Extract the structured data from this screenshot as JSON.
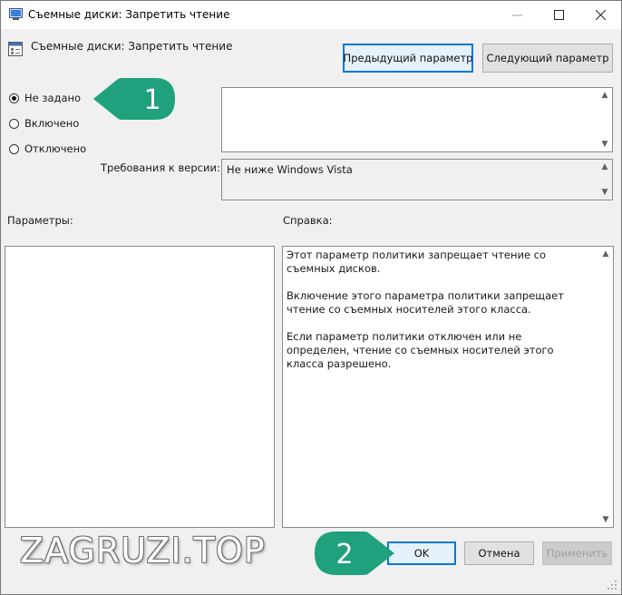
{
  "window": {
    "title": "Съемные диски: Запретить чтение",
    "controls": {
      "minimize": "—",
      "maximize": "☐",
      "close": "✕"
    }
  },
  "header": {
    "policy_name": "Съемные диски: Запретить чтение",
    "prev_button": "Предыдущий параметр",
    "next_button": "Следующий параметр"
  },
  "state": {
    "options": [
      {
        "label": "Не задано",
        "checked": true
      },
      {
        "label": "Включено",
        "checked": false
      },
      {
        "label": "Отключено",
        "checked": false
      }
    ]
  },
  "comment": {
    "value": ""
  },
  "requirements": {
    "label": "Требования к версии:",
    "value": "Не ниже Windows Vista"
  },
  "options_panel": {
    "label": "Параметры:"
  },
  "help_panel": {
    "label": "Справка:",
    "paragraphs": [
      "Этот параметр политики запрещает чтение со съемных дисков.",
      "Включение этого параметра политики запрещает чтение со съемных носителей этого класса.",
      "Если параметр политики отключен или не определен, чтение со съемных носителей этого класса разрешено."
    ]
  },
  "footer": {
    "ok": "OK",
    "cancel": "Отмена",
    "apply": "Применить"
  },
  "annotations": {
    "step1": "1",
    "step2": "2",
    "color": "#1fa17d"
  },
  "watermark": {
    "text": "ZAGRUZI.TOP"
  }
}
